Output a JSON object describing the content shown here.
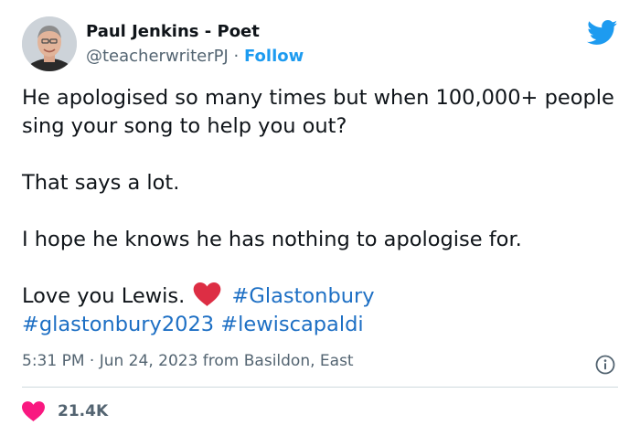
{
  "author": {
    "name": "Paul Jenkins - Poet",
    "handle": "@teacherwriterPJ",
    "separator": "·",
    "follow_label": "Follow"
  },
  "tweet": {
    "line1": "He apologised so many times but when 100,000+ people sing your song to help you out?",
    "line2": "That says a lot.",
    "line3": "I hope he knows he has nothing to apologise for.",
    "line4_text": "Love you Lewis.",
    "hashtags": [
      "#Glastonbury",
      "#glastonbury2023",
      "#lewiscapaldi"
    ],
    "emoji": "red-heart"
  },
  "meta": {
    "time": "5:31 PM",
    "separator": "·",
    "date": "Jun 24, 2023",
    "location": "from Basildon, East"
  },
  "stats": {
    "likes": "21.4K"
  },
  "colors": {
    "text": "#0f1419",
    "secondary": "#536471",
    "link": "#1d9bf0",
    "heart": "#f91880",
    "divider": "#cfd9de"
  },
  "icons": [
    "twitter-bird-icon",
    "info-icon",
    "heart-icon",
    "red-heart-emoji"
  ]
}
